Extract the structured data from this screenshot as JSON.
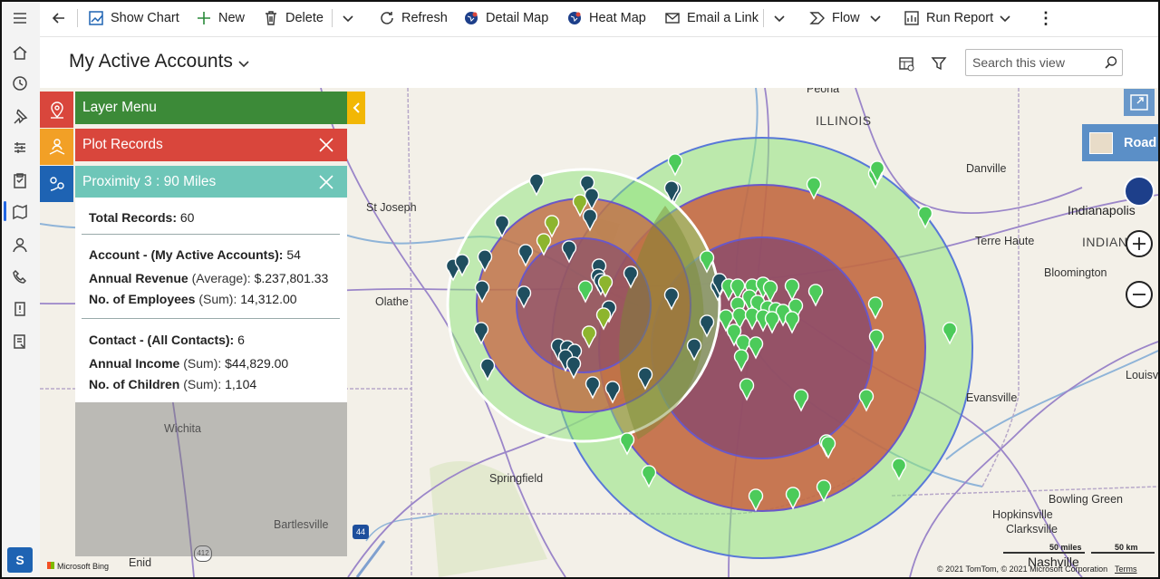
{
  "command_bar": {
    "show_chart": "Show Chart",
    "new": "New",
    "delete": "Delete",
    "refresh": "Refresh",
    "detail_map": "Detail Map",
    "heat_map": "Heat Map",
    "email_link": "Email a Link",
    "flow": "Flow",
    "run_report": "Run Report"
  },
  "header": {
    "title": "My Active Accounts",
    "search_placeholder": "Search this view"
  },
  "user": {
    "initial": "S"
  },
  "layer_panel": {
    "layer_menu": "Layer Menu",
    "plot_records": "Plot Records",
    "proximity": "Proximity 3 : 90 Miles",
    "colors": {
      "layer_menu": "#3c8a38",
      "plot_records": "#d9463c",
      "proximity": "#6ec6b8",
      "collapse": "#f2b705"
    },
    "stats": {
      "total_label": "Total Records:",
      "total_value": "60",
      "account_label": "Account - (My Active Accounts):",
      "account_value": "54",
      "revenue_label": "Annual Revenue",
      "revenue_agg": "(Average):",
      "revenue_value": "$.237,801.33",
      "employees_label": "No. of Employees",
      "employees_agg": "(Sum):",
      "employees_value": "14,312.00",
      "contact_label": "Contact - (All Contacts):",
      "contact_value": "6",
      "income_label": "Annual Income",
      "income_agg": "(Sum):",
      "income_value": "$44,829.00",
      "children_label": "No. of Children",
      "children_agg": "(Sum):",
      "children_value": "1,104"
    }
  },
  "map": {
    "road_label": "Road",
    "labels": {
      "peoria": "Peoria",
      "illinois": "ILLINOIS",
      "danville": "Danville",
      "indianapolis": "Indianapolis",
      "indiana": "INDIAN",
      "st_joseph": "St Joseph",
      "terre_haute": "Terre Haute",
      "bloomington": "Bloomington",
      "olathe": "Olathe",
      "louisv": "Louisv",
      "wichita": "Wichita",
      "evansville": "Evansville",
      "springfield": "Springfield",
      "bowling_green": "Bowling Green",
      "hopkinsville": "Hopkinsville",
      "clarksville": "Clarksville",
      "bartlesville": "Bartlesville",
      "enid": "Enid",
      "nashville": "Nashville",
      "route_44": "44",
      "route_412": "412"
    },
    "scale_miles": "50 miles",
    "scale_km": "50 km",
    "copyright": "© 2021 TomTom, © 2021 Microsoft Corporation",
    "terms": "Terms",
    "bing": "Microsoft Bing",
    "pin_colors": {
      "account": "#1f4e5f",
      "contact_green": "#4ccb5a",
      "contact_olive": "#8db52e"
    }
  }
}
